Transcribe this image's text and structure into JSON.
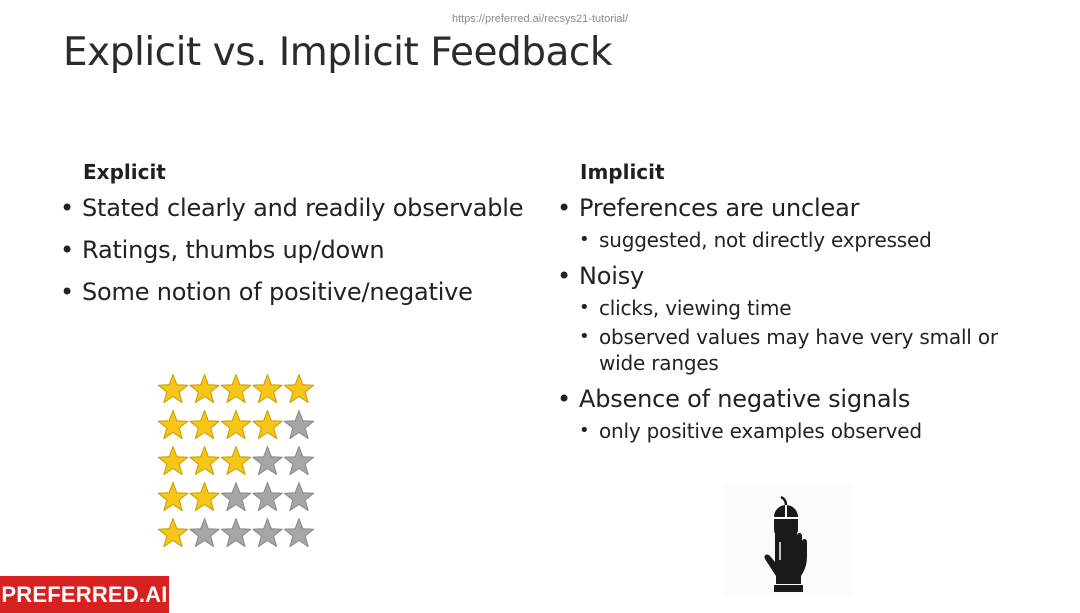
{
  "header": {
    "url": "https://preferred.ai/recsys21-tutorial/",
    "title": "Explicit vs. Implicit Feedback"
  },
  "explicit": {
    "heading": "Explicit",
    "bullets": [
      "Stated clearly and readily observable",
      "Ratings, thumbs up/down",
      "Some notion of positive/negative"
    ],
    "star_rows": [
      5,
      4,
      3,
      2,
      1
    ],
    "star_colors": {
      "filled": "#f5c518",
      "empty": "#a6a6a6"
    }
  },
  "implicit": {
    "heading": "Implicit",
    "items": [
      {
        "text": "Preferences are unclear",
        "sub": [
          "suggested, not directly expressed"
        ]
      },
      {
        "text": "Noisy",
        "sub": [
          "clicks, viewing time",
          "observed values may have very small or wide ranges"
        ]
      },
      {
        "text": "Absence of negative signals",
        "sub": [
          "only positive examples observed"
        ]
      }
    ],
    "icon": "hand-clicking-mouse-icon"
  },
  "logo": {
    "text": "PREFERRED.AI",
    "color": "#d72020"
  }
}
